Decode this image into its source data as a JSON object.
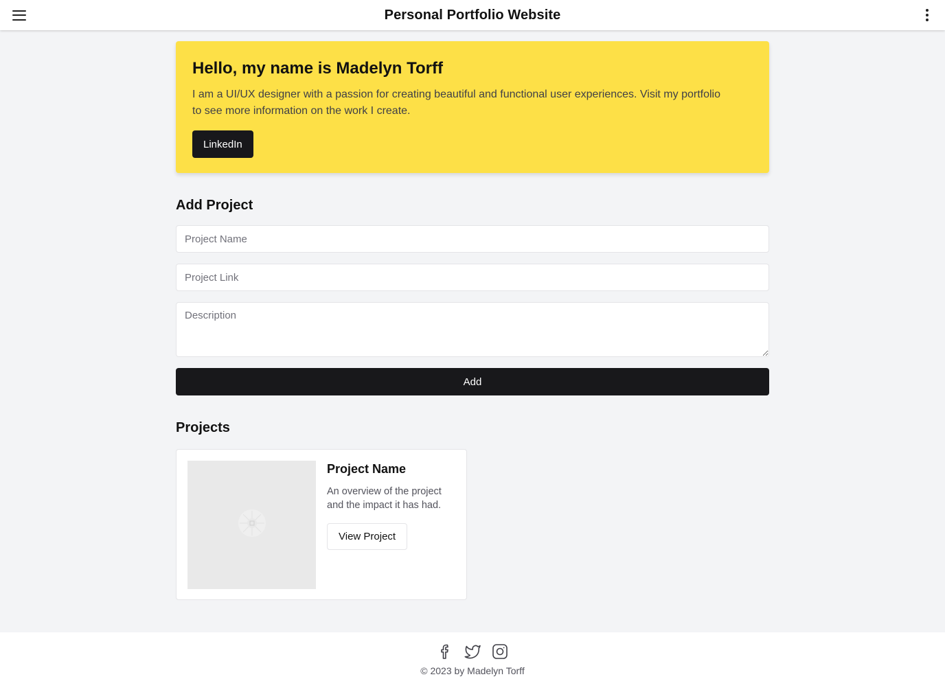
{
  "app": {
    "title": "Personal Portfolio Website",
    "icons": {
      "menu": "hamburger-menu-icon",
      "more": "more-vertical-icon"
    }
  },
  "hero": {
    "heading": "Hello, my name is Madelyn Torff",
    "text": "I am a UI/UX designer with a passion for creating beautiful and functional user experiences. Visit my portfolio to see more information on the work I create.",
    "button_label": "LinkedIn",
    "background_color": "#fde047"
  },
  "add_project": {
    "title": "Add Project",
    "name_placeholder": "Project Name",
    "link_placeholder": "Project Link",
    "description_placeholder": "Description",
    "submit_label": "Add"
  },
  "projects": {
    "title": "Projects",
    "items": [
      {
        "name": "Project Name",
        "description": "An overview of the project and the impact it has had.",
        "button_label": "View Project",
        "image_icon": "image-placeholder-icon"
      }
    ]
  },
  "footer": {
    "social_icons": [
      "facebook-icon",
      "twitter-icon",
      "instagram-icon"
    ],
    "copyright": "© 2023 by Madelyn Torff"
  }
}
